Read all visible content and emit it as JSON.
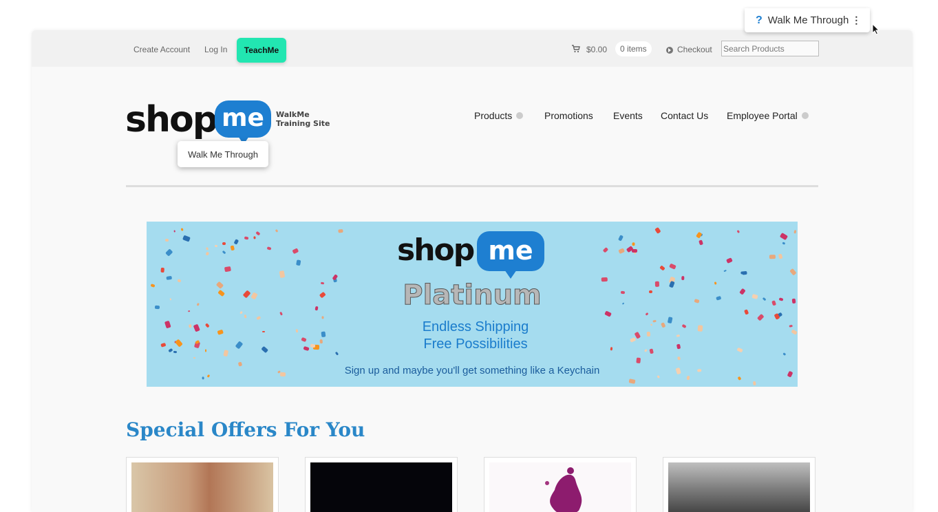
{
  "topbar": {
    "create_account": "Create Account",
    "log_in": "Log In",
    "teachme": "TeachMe",
    "cart_total": "$0.00",
    "items": "0 items",
    "checkout": "Checkout",
    "search_placeholder": "Search Products"
  },
  "logo": {
    "shop": "shop",
    "me": "me",
    "tagline_line1": "WalkMe",
    "tagline_line2": "Training Site"
  },
  "tooltip": {
    "label": "Walk Me Through"
  },
  "nav": {
    "products": "Products",
    "promotions": "Promotions",
    "events": "Events",
    "contact_us": "Contact Us",
    "employee_portal": "Employee Portal"
  },
  "banner": {
    "shop": "shop",
    "me": "me",
    "title": "Platinum",
    "line1": "Endless Shipping",
    "line2": "Free Possibilities",
    "footer": "Sign up and maybe you'll get something like a Keychain"
  },
  "section": {
    "title": "Special Offers For You"
  },
  "walkme_widget": {
    "icon": "?",
    "label": "Walk Me Through",
    "menu": "⋮"
  },
  "colors": {
    "teachme_accent": "#22e6b1",
    "brand_blue": "#1e7fd1",
    "section_title": "#2a87c8",
    "banner_bg": "#a5dcef"
  }
}
